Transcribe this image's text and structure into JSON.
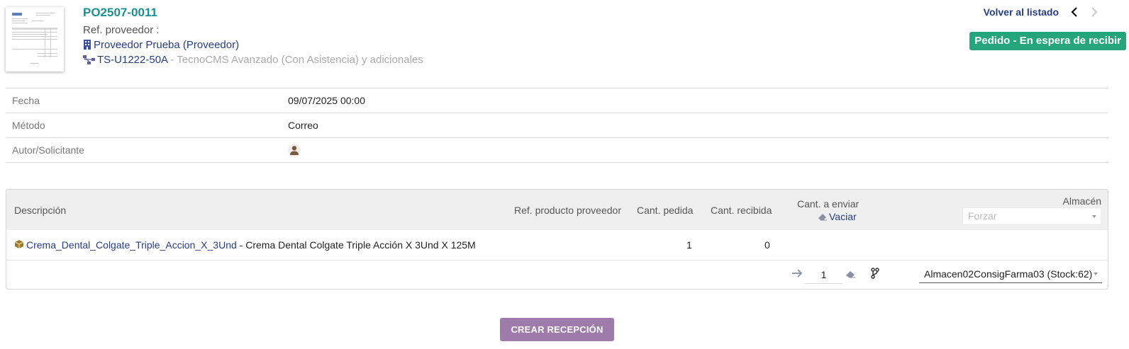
{
  "header": {
    "reference": "PO2507-0011",
    "supplier_ref_label": "Ref. proveedor :",
    "supplier_ref_value": "",
    "supplier_name": "Proveedor Prueba (Proveedor)",
    "project_code": "TS-U1222-50A",
    "project_separator": " - ",
    "project_name": "TecnoCMS Avanzado (Con Asistencia) y adicionales",
    "back_label": "Volver al listado",
    "status": "Pedido - En espera de recibir",
    "status_color": "#25a57c",
    "icons": {
      "supplier": "building-icon",
      "project": "project-tree-icon",
      "prev": "chevron-left-icon",
      "next": "chevron-right-icon"
    }
  },
  "info": {
    "rows": [
      {
        "label": "Fecha",
        "value": "09/07/2025 00:00"
      },
      {
        "label": "Método",
        "value": "Correo"
      },
      {
        "label": "Autor/Solicitante",
        "value": ""
      }
    ]
  },
  "lines": {
    "headers": {
      "description": "Descripción",
      "supplier_product_ref": "Ref. producto proveedor",
      "qty_ordered": "Cant. pedida",
      "qty_received": "Cant. recibida",
      "qty_to_send": "Cant. a enviar",
      "clear": "Vaciar",
      "warehouse": "Almacén",
      "force_placeholder": "Forzar"
    },
    "items": [
      {
        "product_code": "Crema_Dental_Colgate_Triple_Accion_X_3Und",
        "separator": " - ",
        "product_label": "Crema Dental Colgate Triple Acción X 3Und X 125M",
        "qty_ordered": "1",
        "qty_received": "0",
        "qty_to_send": "1",
        "warehouse": "Almacen02ConsigFarma03 (Stock:62)"
      }
    ]
  },
  "actions": {
    "create_reception": "CREAR RECEPCIÓN",
    "button_color": "#9e7bab"
  }
}
